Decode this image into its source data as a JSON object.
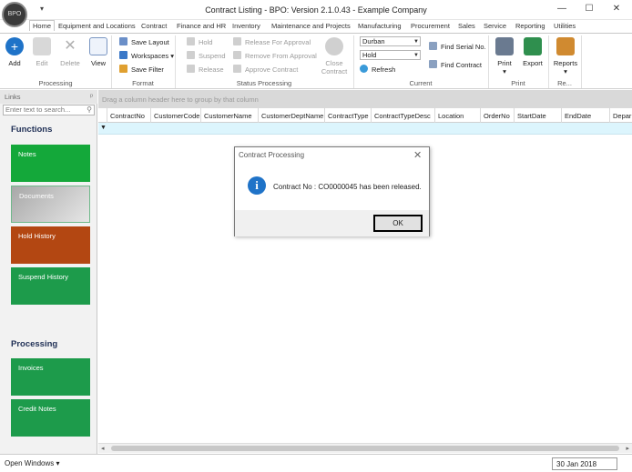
{
  "window": {
    "title": "Contract Listing - BPO: Version 2.1.0.43 - Example Company",
    "logo_text": "BPO",
    "qat_glyph": "▾",
    "min_glyph": "—",
    "max_glyph": "☐",
    "close_glyph": "✕"
  },
  "tabs": [
    "Home",
    "Equipment and Locations",
    "Contract",
    "Finance and HR",
    "Inventory",
    "Maintenance and Projects",
    "Manufacturing",
    "Procurement",
    "Sales",
    "Service",
    "Reporting",
    "Utilities"
  ],
  "ribbon": {
    "processing": {
      "label": "Processing",
      "add": "Add",
      "edit": "Edit",
      "delete": "Delete",
      "view": "View"
    },
    "format": {
      "label": "Format",
      "save_layout": "Save Layout",
      "workspaces": "Workspaces ▾",
      "save_filter": "Save Filter"
    },
    "status_processing": {
      "label": "Status Processing",
      "hold": "Hold",
      "suspend": "Suspend",
      "release": "Release",
      "release_for_approval": "Release For Approval",
      "remove_from_approval": "Remove From Approval",
      "approve_contract": "Approve Contract",
      "close_contract_1": "Close",
      "close_contract_2": "Contract"
    },
    "current": {
      "label": "Current",
      "site_value": "Durban",
      "status_value": "Hold",
      "refresh": "Refresh",
      "find_serial": "Find Serial No.",
      "find_contract": "Find Contract"
    },
    "print": {
      "label": "Print",
      "print": "Print",
      "print_arrow": "▾",
      "export": "Export"
    },
    "reports": {
      "label": "Re...",
      "reports": "Reports",
      "reports_arrow": "▾"
    }
  },
  "links": {
    "header": "Links",
    "pin": "ᵖ",
    "search_placeholder": "Enter text to search...",
    "functions_title": "Functions",
    "functions": [
      "Notes",
      "Documents",
      "Hold History",
      "Suspend History"
    ],
    "processing_title": "Processing",
    "processing": [
      "Invoices",
      "Credit Notes"
    ]
  },
  "grid": {
    "group_hint": "Drag a column header here to group by that column",
    "columns": [
      "ContractNo",
      "CustomerCode",
      "CustomerName",
      "CustomerDeptName",
      "ContractType",
      "ContractTypeDesc",
      "Location",
      "OrderNo",
      "StartDate",
      "EndDate",
      "Depar"
    ],
    "filter_glyph": "▼"
  },
  "status": {
    "open_windows": "Open Windows ▾",
    "date": "30 Jan 2018"
  },
  "dialog": {
    "title": "Contract Processing",
    "close": "✕",
    "info_glyph": "i",
    "message": "Contract No : CO0000045 has been released.",
    "ok": "OK"
  },
  "colors": {
    "accent": "#1f73c8",
    "notes": "#14a83a",
    "documents": "#c8c8c8",
    "hold_history": "#b34712",
    "green_tile": "#1d9b4b"
  }
}
